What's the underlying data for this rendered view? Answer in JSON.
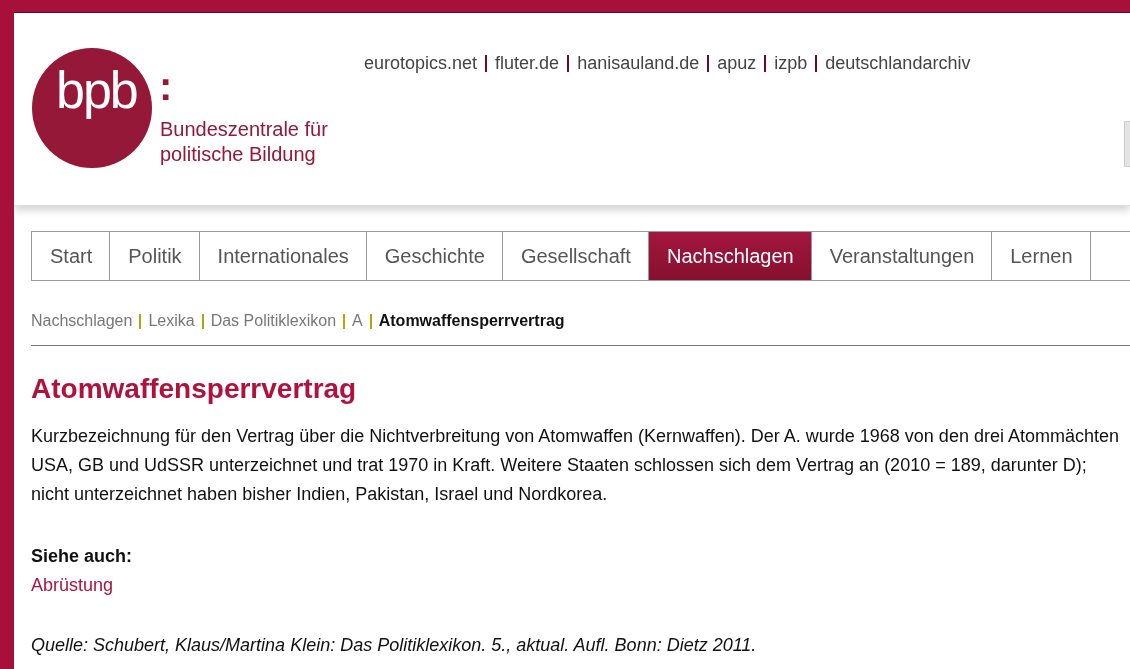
{
  "logo": {
    "mark": "bpb",
    "colon": ":",
    "tagline": [
      "Bundeszentrale für",
      "politische Bildung"
    ]
  },
  "top_links": [
    "eurotopics.net",
    "fluter.de",
    "hanisauland.de",
    "apuz",
    "izpb",
    "deutschlandarchiv"
  ],
  "tabs": [
    {
      "label": "Start",
      "selected": false
    },
    {
      "label": "Politik",
      "selected": false
    },
    {
      "label": "Internationales",
      "selected": false
    },
    {
      "label": "Geschichte",
      "selected": false
    },
    {
      "label": "Gesellschaft",
      "selected": false
    },
    {
      "label": "Nachschlagen",
      "selected": true
    },
    {
      "label": "Veranstaltungen",
      "selected": false
    },
    {
      "label": "Lernen",
      "selected": false
    }
  ],
  "breadcrumb": [
    {
      "label": "Nachschlagen",
      "current": false
    },
    {
      "label": "Lexika",
      "current": false
    },
    {
      "label": "Das Politiklexikon",
      "current": false
    },
    {
      "label": "A",
      "current": false
    },
    {
      "label": "Atomwaffensperrvertrag",
      "current": true
    }
  ],
  "article": {
    "title": "Atomwaffensperrvertrag",
    "body": "Kurzbezeichnung für den Vertrag über die Nichtverbreitung von Atomwaffen (Kernwaffen). Der A. wurde 1968 von den drei Atommächten USA, GB und UdSSR unterzeichnet und trat 1970 in Kraft. Weitere Staaten schlossen sich dem Vertrag an (2010 = 189, darunter D); nicht unterzeichnet haben bisher Indien, Pakistan, Israel und Nordkorea.",
    "see_also_label": "Siehe auch:",
    "see_also": [
      "Abrüstung"
    ],
    "source": "Quelle: Schubert, Klaus/Martina Klein: Das Politiklexikon. 5., aktual. Aufl. Bonn: Dietz 2011."
  }
}
